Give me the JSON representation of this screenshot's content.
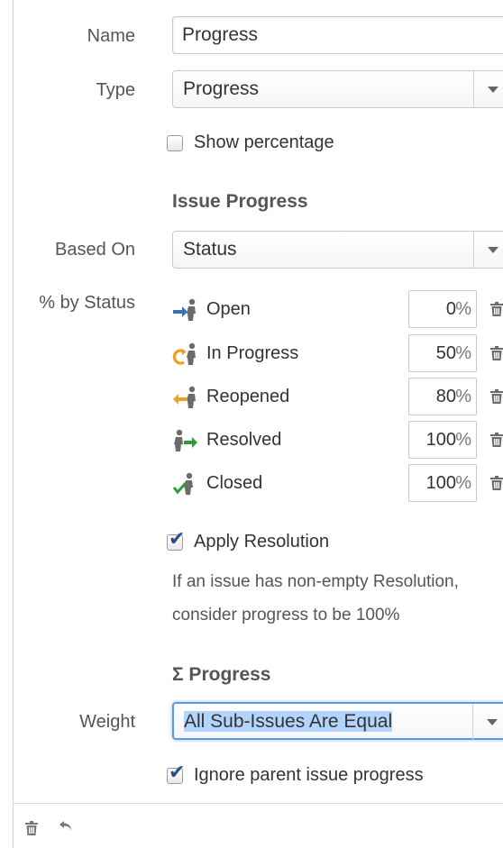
{
  "form": {
    "name_label": "Name",
    "name_value": "Progress",
    "type_label": "Type",
    "type_value": "Progress",
    "show_percentage_label": "Show percentage",
    "issue_progress_title": "Issue Progress",
    "based_on_label": "Based On",
    "based_on_value": "Status",
    "by_status_label": "% by Status",
    "statuses": [
      {
        "label": "Open",
        "value": "0",
        "unit": "%",
        "icon": "open-status-icon"
      },
      {
        "label": "In Progress",
        "value": "50",
        "unit": "%",
        "icon": "in-progress-status-icon"
      },
      {
        "label": "Reopened",
        "value": "80",
        "unit": "%",
        "icon": "reopened-status-icon"
      },
      {
        "label": "Resolved",
        "value": "100",
        "unit": "%",
        "icon": "resolved-status-icon"
      },
      {
        "label": "Closed",
        "value": "100",
        "unit": "%",
        "icon": "closed-status-icon"
      }
    ],
    "apply_resolution_label": "Apply Resolution",
    "apply_resolution_desc_1": "If an issue has non-empty Resolution,",
    "apply_resolution_desc_2": "consider progress to be 100%",
    "sigma_progress_title": "Σ Progress",
    "weight_label": "Weight",
    "weight_value": "All Sub-Issues Are Equal",
    "ignore_parent_label": "Ignore parent issue progress"
  },
  "colors": {
    "accent_blue": "#3b6fb6",
    "focus_ring": "#5a9be3",
    "selection": "#b3d4fc",
    "orange": "#f0a020",
    "green": "#2e9a3a"
  }
}
